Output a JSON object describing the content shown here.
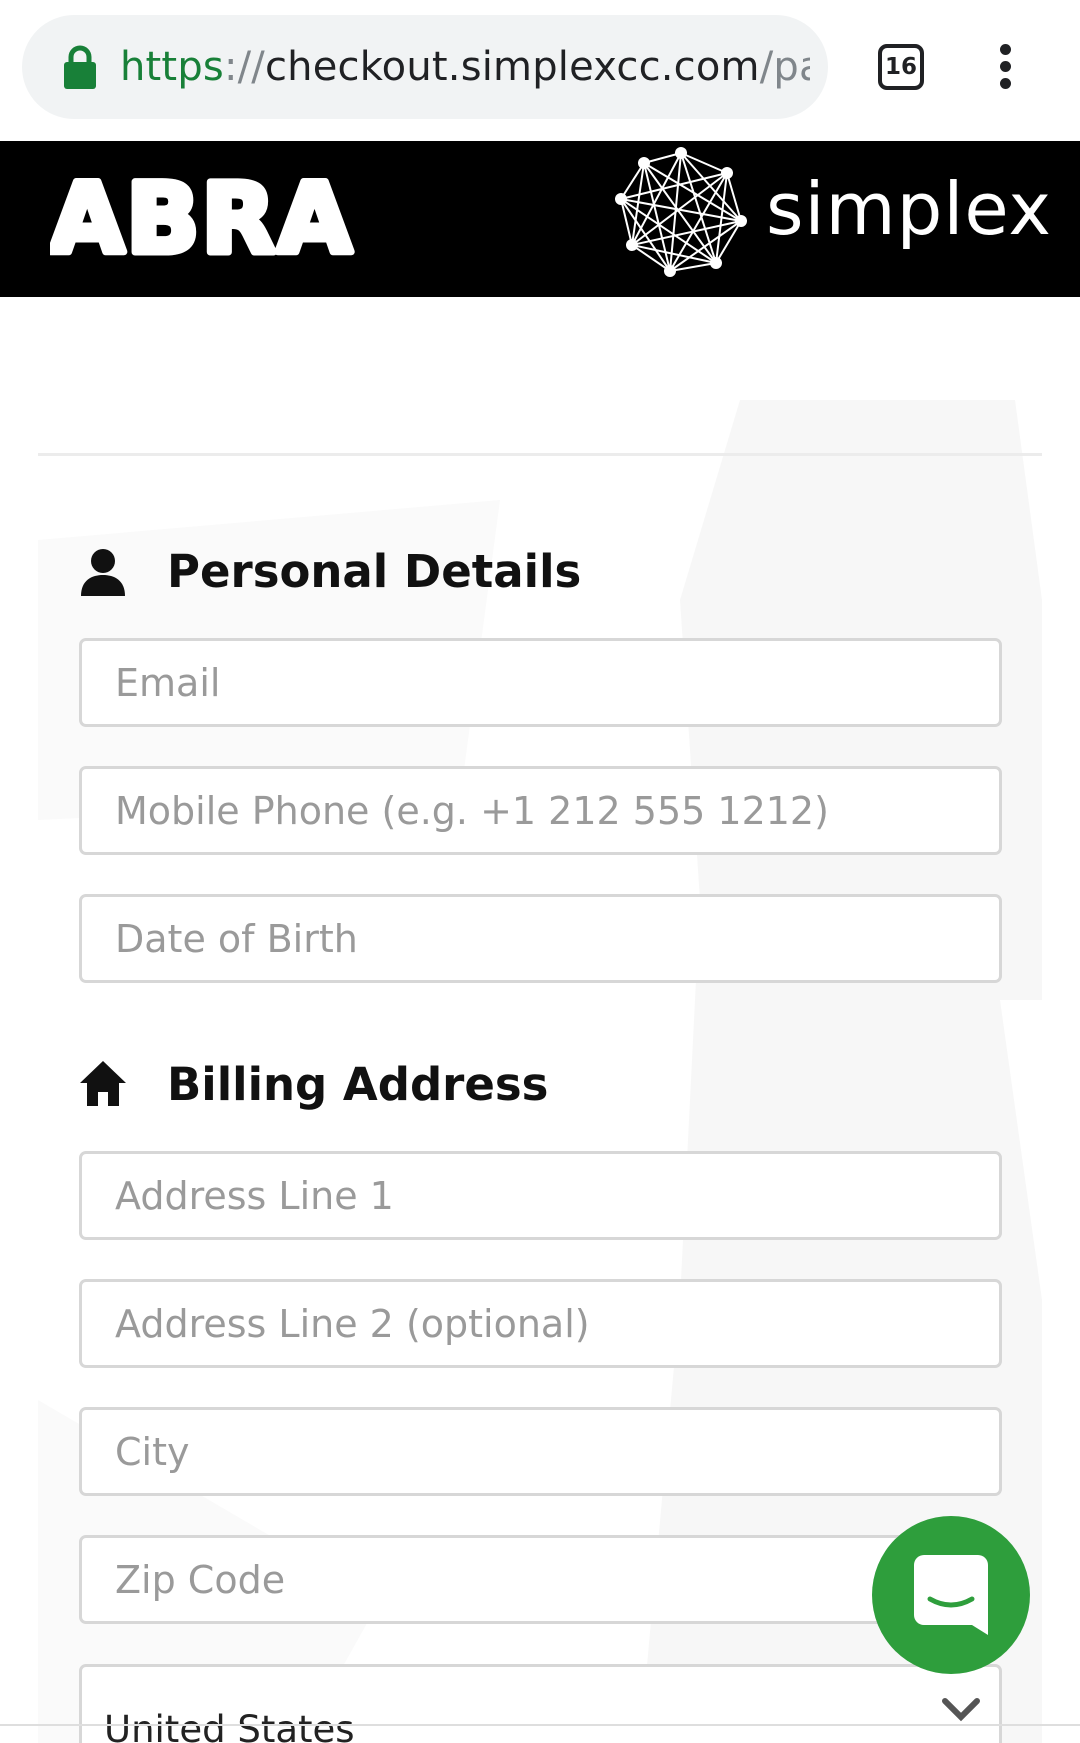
{
  "browser": {
    "url_scheme": "https",
    "url_separator": "://",
    "url_host": "checkout.simplexcc.com",
    "url_path": "/pay",
    "tab_count": "16",
    "lock_icon": "lock-icon",
    "menu_icon": "overflow-menu-icon"
  },
  "banner": {
    "left_logo": "ABRA",
    "right_logo_text": "simplex"
  },
  "personal": {
    "title": "Personal Details",
    "icon": "person-icon",
    "email_placeholder": "Email",
    "phone_placeholder": "Mobile Phone (e.g. +1 212 555 1212)",
    "dob_placeholder": "Date of Birth"
  },
  "billing": {
    "title": "Billing Address",
    "icon": "home-icon",
    "address1_placeholder": "Address Line 1",
    "address2_placeholder": "Address Line 2 (optional)",
    "city_placeholder": "City",
    "zip_placeholder": "Zip Code",
    "country_value": "United States"
  },
  "colors": {
    "url_scheme": "#188038",
    "banner_bg": "#000000",
    "chat_button": "#2e9e3c"
  }
}
